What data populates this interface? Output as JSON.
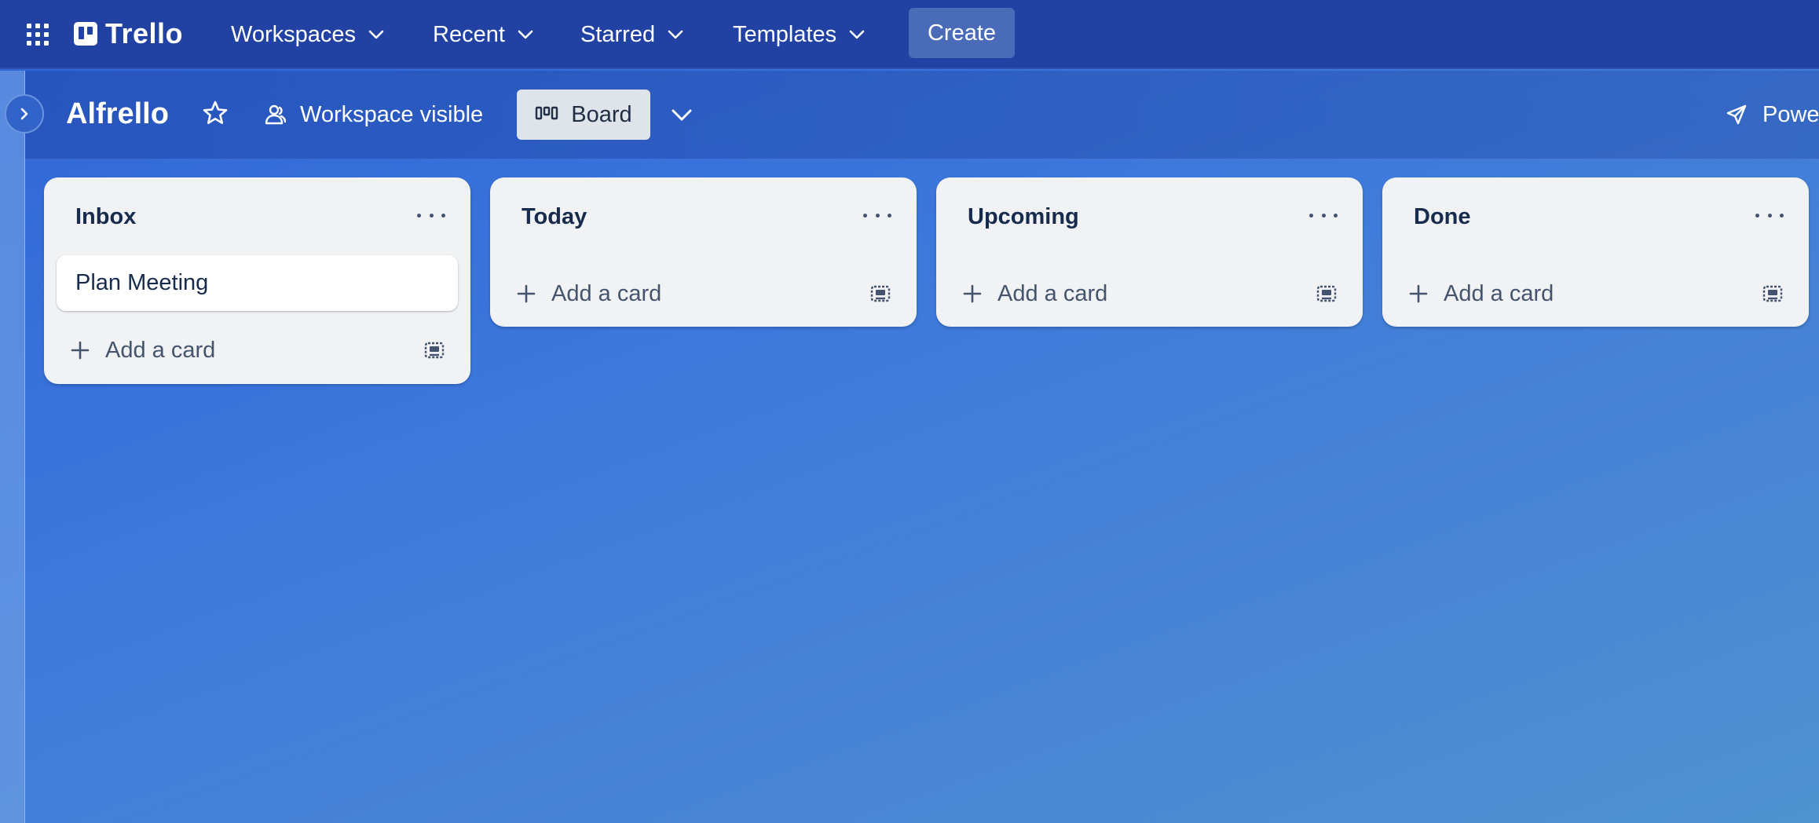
{
  "topnav": {
    "logo_text": "Trello",
    "items": [
      {
        "label": "Workspaces"
      },
      {
        "label": "Recent"
      },
      {
        "label": "Starred"
      },
      {
        "label": "Templates"
      }
    ],
    "create_label": "Create"
  },
  "board": {
    "title": "Alfrello",
    "visibility_label": "Workspace visible",
    "view_label": "Board",
    "power_ups_label": "Powe"
  },
  "lists": [
    {
      "title": "Inbox",
      "cards": [
        "Plan Meeting"
      ],
      "add_label": "Add a card"
    },
    {
      "title": "Today",
      "cards": [],
      "add_label": "Add a card"
    },
    {
      "title": "Upcoming",
      "cards": [],
      "add_label": "Add a card"
    },
    {
      "title": "Done",
      "cards": [],
      "add_label": "Add a card"
    }
  ],
  "colors": {
    "nav_bg": "#2141a3",
    "list_bg": "#f1f2f4",
    "text_dark": "#172b4d"
  }
}
